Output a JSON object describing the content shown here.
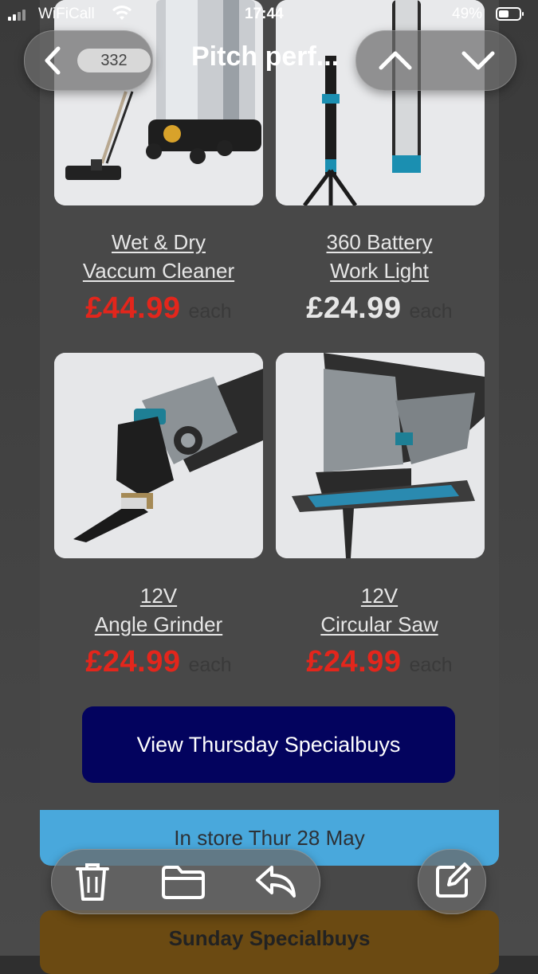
{
  "status_bar": {
    "carrier": "WiFiCall",
    "time": "17:44",
    "battery": "49%"
  },
  "nav": {
    "unread_count": "332",
    "title": "Pitch perf..."
  },
  "products": [
    {
      "name_line1": "Wet & Dry",
      "name_line2": "Vaccum Cleaner",
      "price": "£44.99",
      "price_color": "#e3261c",
      "each": "each"
    },
    {
      "name_line1": "360 Battery",
      "name_line2": "Work Light",
      "price": "£24.99",
      "price_color": "#e6e6e6",
      "each": "each"
    },
    {
      "name_line1": "12V ",
      "name_line2": "Angle Grinder",
      "price": "£24.99",
      "price_color": "#e3261c",
      "each": "each"
    },
    {
      "name_line1": "12V ",
      "name_line2": "Circular Saw",
      "price": "£24.99",
      "price_color": "#e3261c",
      "each": "each"
    }
  ],
  "cta": {
    "label": "View Thursday Specialbuys"
  },
  "instore": {
    "label": "In store Thur 28 May"
  },
  "sunday": {
    "label": "Sunday Specialbuys"
  },
  "toolbar": {
    "icons": [
      "trash-icon",
      "folder-icon",
      "reply-icon",
      "compose-icon"
    ]
  },
  "colors": {
    "cta_bg": "#03035e",
    "instore_bg": "#49a8dc",
    "sunday_bg": "#6b4a12"
  }
}
